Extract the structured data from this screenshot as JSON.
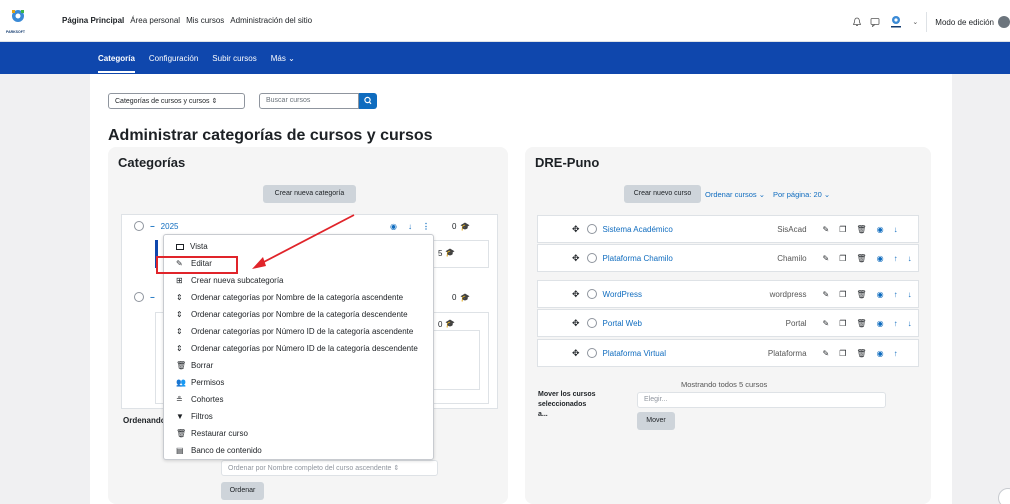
{
  "topbar": {
    "logo_text": "PARKSOFT",
    "nav": [
      "Página Principal",
      "Área personal",
      "Mis cursos",
      "Administración del sitio"
    ],
    "edit_mode_label": "Modo de edición"
  },
  "subnav": {
    "items": [
      "Categoría",
      "Configuración",
      "Subir cursos",
      "Más ⌄"
    ]
  },
  "controls": {
    "category_select": "Categorías de cursos y cursos ⇕",
    "search_placeholder": "Buscar cursos"
  },
  "page_title": "Administrar categorías de cursos y cursos",
  "left_card": {
    "title": "Categorías",
    "create_button": "Crear nueva categoría",
    "category_2025": {
      "name": "2025",
      "count": "0"
    },
    "sub_count": "5",
    "cat2_count": "0",
    "sub2_count": "0",
    "sorting_label": "Ordenando",
    "sort_select": "Ordenar por Nombre completo del curso ascendente ⇕",
    "sort_button": "Ordenar"
  },
  "menu": {
    "items": [
      {
        "label": "Vista",
        "icon": "display-icon"
      },
      {
        "label": "Editar",
        "icon": "pencil-icon"
      },
      {
        "label": "Crear nueva subcategoría",
        "icon": "sitemap-icon"
      },
      {
        "label": "Ordenar categorías por Nombre de la categoría ascendente",
        "icon": "sort-icon"
      },
      {
        "label": "Ordenar categorías por Nombre de la categoría descendente",
        "icon": "sort-icon"
      },
      {
        "label": "Ordenar categorías por Número ID de la categoría ascendente",
        "icon": "sort-icon"
      },
      {
        "label": "Ordenar categorías por Número ID de la categoría descendente",
        "icon": "sort-icon"
      },
      {
        "label": "Borrar",
        "icon": "trash-icon"
      },
      {
        "label": "Permisos",
        "icon": "users-icon"
      },
      {
        "label": "Cohortes",
        "icon": "cohort-icon"
      },
      {
        "label": "Filtros",
        "icon": "filter-icon"
      },
      {
        "label": "Restaurar curso",
        "icon": "restore-icon"
      },
      {
        "label": "Banco de contenido",
        "icon": "bank-icon"
      }
    ]
  },
  "right_card": {
    "title": "DRE-Puno",
    "create_course_button": "Crear nuevo curso",
    "sort_courses": "Ordenar cursos ⌄",
    "per_page": "Por página: 20 ⌄",
    "courses": [
      {
        "name": "Sistema Académico",
        "short": "SisAcad"
      },
      {
        "name": "Plataforma Chamilo",
        "short": "Chamilo"
      },
      {
        "name": "WordPress",
        "short": "wordpress"
      },
      {
        "name": "Portal Web",
        "short": "Portal"
      },
      {
        "name": "Plataforma Virtual",
        "short": "Plataforma"
      }
    ],
    "showing": "Mostrando todos 5 cursos",
    "move_label_1": "Mover los cursos",
    "move_label_2": "seleccionados",
    "move_label_3": "a...",
    "move_select": "Elegir...",
    "move_button": "Mover"
  },
  "colors": {
    "brand_blue": "#0f47ad",
    "accent": "#0f6cbf",
    "annotation_red": "#e0242a"
  }
}
